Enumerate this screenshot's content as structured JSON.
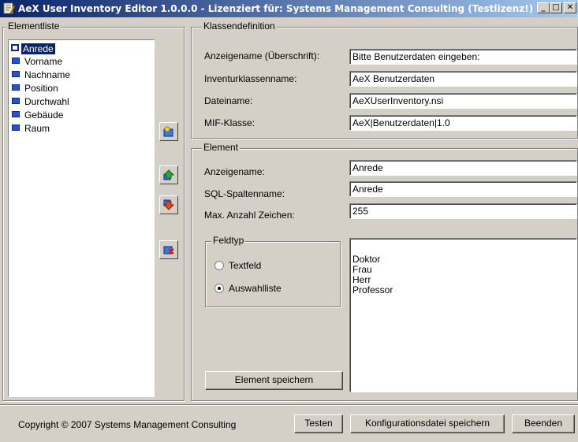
{
  "window": {
    "title": "AeX User Inventory Editor 1.0.0.0 - Lizenziert für: Systems Management Consulting (Testlizenz!)",
    "minimize_glyph": "_",
    "maximize_glyph": "□",
    "close_glyph": "✕"
  },
  "elementliste": {
    "legend": "Elementliste",
    "items": [
      "Anrede",
      "Vorname",
      "Nachname",
      "Position",
      "Durchwahl",
      "Gebäude",
      "Raum"
    ],
    "selected": "Anrede"
  },
  "klassendefinition": {
    "legend": "Klassendefinition",
    "anzeigename_label": "Anzeigename (Überschrift):",
    "anzeigename_value": "Bitte Benutzerdaten eingeben:",
    "inventurklassenname_label": "Inventurklassenname:",
    "inventurklassenname_value": "AeX Benutzerdaten",
    "dateiname_label": "Dateiname:",
    "dateiname_value": "AeXUserInventory.nsi",
    "mifklasse_label": "MIF-Klasse:",
    "mifklasse_value": "AeX|Benutzerdaten|1.0"
  },
  "element": {
    "legend": "Element",
    "anzeigename_label": "Anzeigename:",
    "anzeigename_value": "Anrede",
    "sql_label": "SQL-Spaltenname:",
    "sql_value": "Anrede",
    "maxzeichen_label": "Max. Anzahl Zeichen:",
    "maxzeichen_value": "255",
    "feldtyp_legend": "Feldtyp",
    "radio_textfeld": "Textfeld",
    "radio_auswahlliste": "Auswahlliste",
    "selected_feldtyp": "Auswahlliste",
    "options": [
      "Doktor",
      "Frau",
      "Herr",
      "Professor"
    ],
    "save_button": "Element speichern"
  },
  "footer": {
    "copyright": "Copyright © 2007 Systems Management Consulting",
    "testen_button": "Testen",
    "konfig_button": "Konfigurationsdatei speichern",
    "beenden_button": "Beenden"
  },
  "colors": {
    "titlebar_start": "#0a246a",
    "titlebar_end": "#a6caf0",
    "selection": "#0a246a",
    "window_face": "#d4d0c8"
  }
}
